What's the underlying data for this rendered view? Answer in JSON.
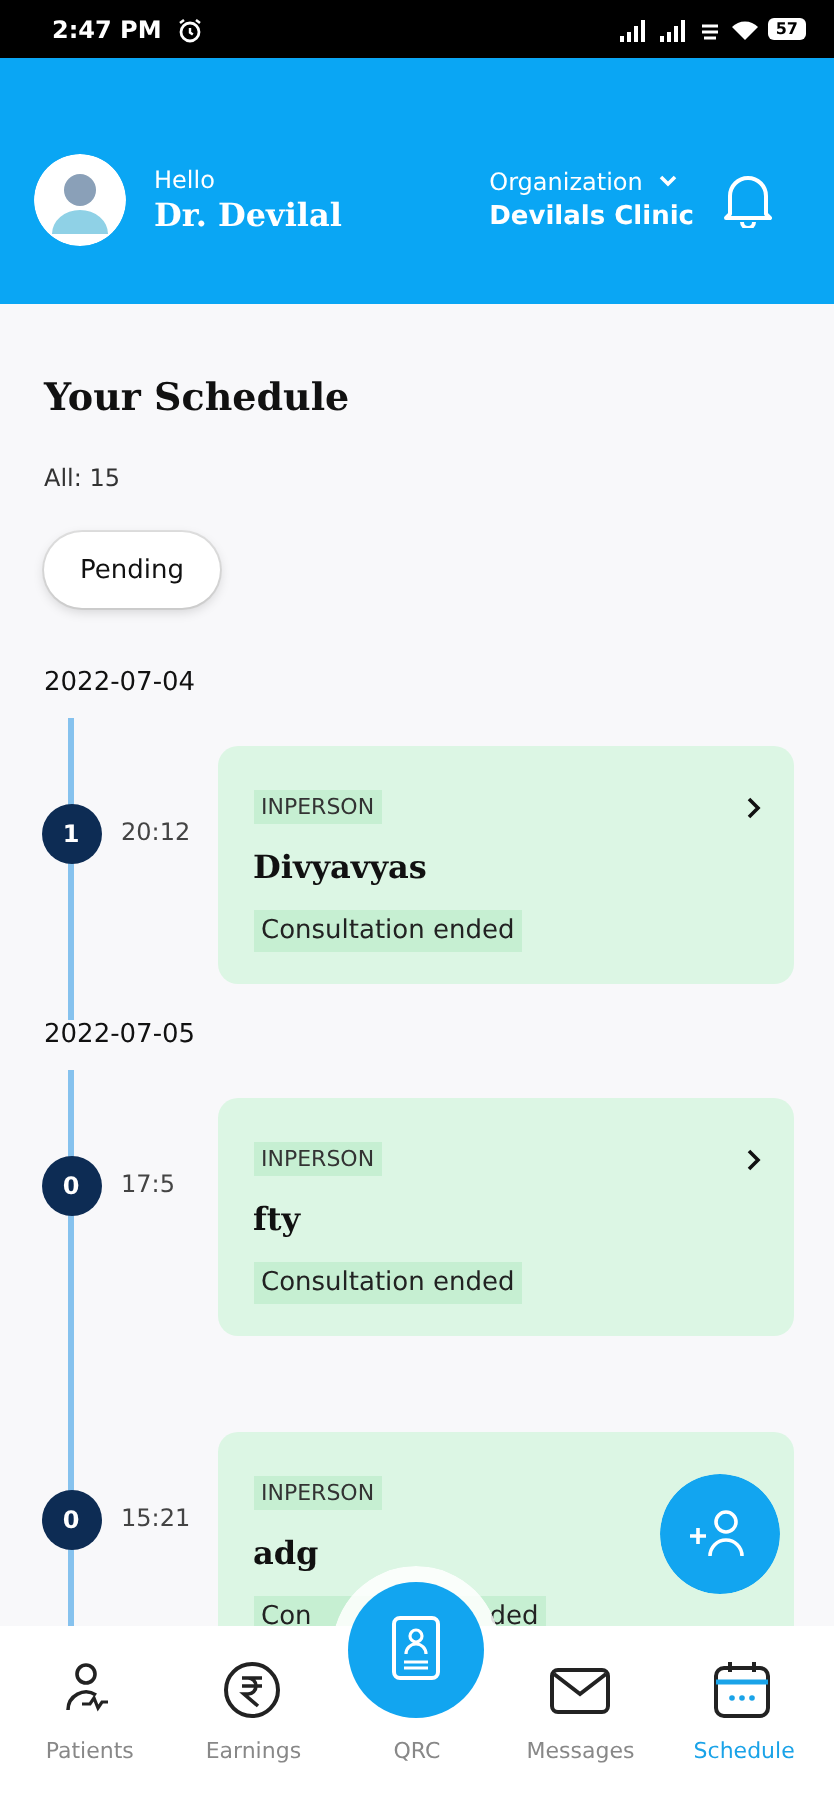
{
  "status_bar": {
    "time": "2:47 PM",
    "battery": "57"
  },
  "header": {
    "greeting": "Hello",
    "name": "Dr. Devilal",
    "org_label": "Organization",
    "org_name": "Devilals Clinic"
  },
  "title": "Your Schedule",
  "count": "All: 15",
  "filter": {
    "label": "Pending",
    "selected": true
  },
  "days": [
    {
      "date": "2022-07-04",
      "appointments": [
        {
          "number": "1",
          "time": "20:12",
          "mode": "INPERSON",
          "patient": "Divyavyas",
          "status": [
            "Consultation ended"
          ],
          "chevron": true
        }
      ]
    },
    {
      "date": "2022-07-05",
      "appointments": [
        {
          "number": "0",
          "time": "17:5",
          "mode": "INPERSON",
          "patient": "fty",
          "status": [
            "Consultation ended"
          ],
          "chevron": true
        },
        {
          "number": "0",
          "time": "15:21",
          "mode": "INPERSON",
          "patient": "adg",
          "status": [
            "Con",
            "ded"
          ],
          "chevron": false
        }
      ]
    }
  ],
  "nav": [
    {
      "kind": "patients",
      "label": "Patients",
      "selected": false
    },
    {
      "kind": "earnings",
      "label": "Earnings",
      "selected": false
    },
    {
      "kind": "qrc",
      "label": "QRC",
      "selected": false
    },
    {
      "kind": "messages",
      "label": "Messages",
      "selected": false
    },
    {
      "kind": "schedule",
      "label": "Schedule",
      "selected": true
    }
  ]
}
